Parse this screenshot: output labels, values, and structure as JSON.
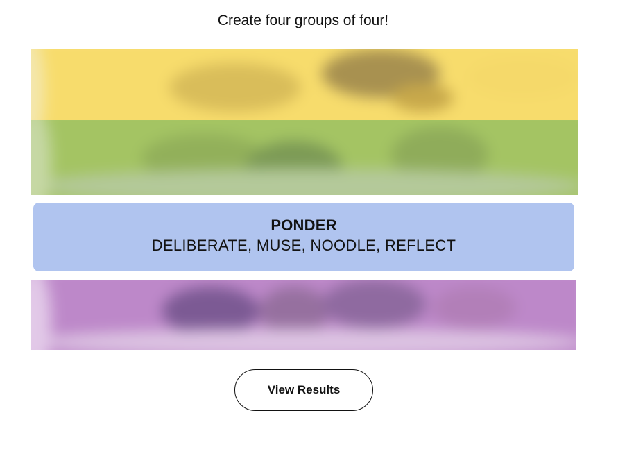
{
  "instructions": "Create four groups of four!",
  "groups": [
    {
      "state": "obscured",
      "color": "#f9df6d",
      "label": "yellow-group"
    },
    {
      "state": "obscured",
      "color": "#a0c35a",
      "label": "green-group"
    },
    {
      "state": "solved",
      "color": "#b0c4ef",
      "title": "PONDER",
      "members": "DELIBERATE, MUSE, NOODLE, REFLECT"
    },
    {
      "state": "obscured",
      "color": "#ba81c5",
      "label": "purple-group"
    }
  ],
  "results_button": {
    "label": "View Results"
  }
}
